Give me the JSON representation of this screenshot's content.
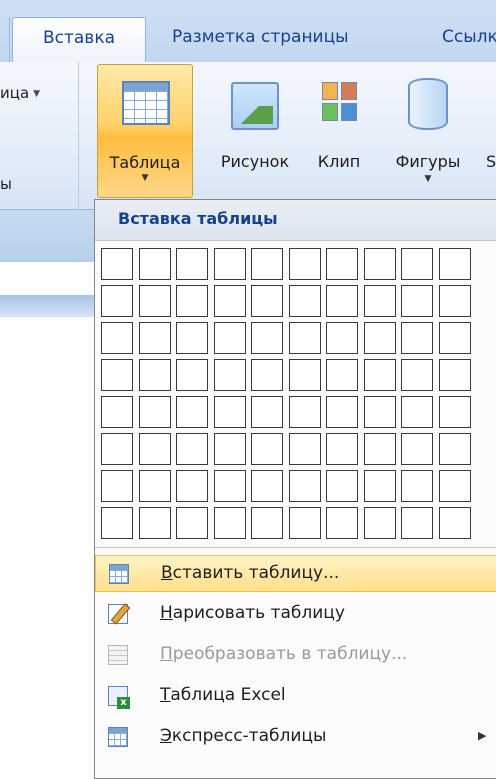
{
  "tabs": {
    "active": "Вставка",
    "items": [
      "Разметка страницы",
      "Ссылк"
    ]
  },
  "ribbon": {
    "left_group": {
      "fragment_top": "ица",
      "fragment_bottom": "ы"
    },
    "buttons": {
      "table": "Таблица",
      "picture": "Рисунок",
      "clip": "Клип",
      "shapes": "Фигуры",
      "cut_off": "S"
    },
    "icons": {
      "table": "table-icon",
      "picture": "picture-icon",
      "clip": "clipart-icon",
      "shapes": "shapes-icon"
    }
  },
  "dropdown": {
    "header": "Вставка таблицы",
    "grid": {
      "columns": 10,
      "rows": 8
    },
    "menu": [
      {
        "accel": "В",
        "rest": "ставить таблицу...",
        "icon": "insert-table-icon",
        "highlighted": true,
        "enabled": true
      },
      {
        "accel": "Н",
        "rest": "арисовать таблицу",
        "icon": "draw-table-icon",
        "highlighted": false,
        "enabled": true
      },
      {
        "accel": "П",
        "rest": "реобразовать в таблицу...",
        "icon": "convert-to-table-icon",
        "highlighted": false,
        "enabled": false
      },
      {
        "accel": "Т",
        "rest": "аблица Excel",
        "icon": "excel-table-icon",
        "highlighted": false,
        "enabled": true
      },
      {
        "accel": "Э",
        "rest": "кспресс-таблицы",
        "icon": "quick-tables-icon",
        "highlighted": false,
        "enabled": true,
        "submenu": true
      }
    ]
  },
  "colors": {
    "accent": "#15428b",
    "highlight": "#ffe08a",
    "button_pressed": "#ffd16a",
    "ribbon": "#dfe9f7"
  }
}
